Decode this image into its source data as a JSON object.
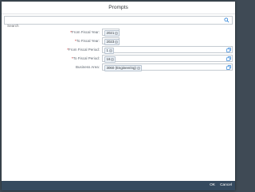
{
  "dialog": {
    "title": "Prompts"
  },
  "search": {
    "placeholder": "Search",
    "value": ""
  },
  "prompts": [
    {
      "label": "From Fiscal Year:",
      "required": true,
      "token": "2021"
    },
    {
      "label": "To Fiscal Year:",
      "required": true,
      "token": "2023"
    },
    {
      "label": "From Fiscal Period:",
      "required": true,
      "token": "1"
    },
    {
      "label": "To Fiscal Period:",
      "required": true,
      "token": "16"
    },
    {
      "label": "Business Area:",
      "required": false,
      "token": "3060 (Engineering)"
    }
  ],
  "footer": {
    "ok_label": "OK",
    "cancel_label": "Cancel"
  },
  "colors": {
    "footer_bg": "#354a5f",
    "required": "#bb0000",
    "icon": "#0a6ed1"
  },
  "icons": {
    "search": "search-icon",
    "value_help": "value-help-icon",
    "remove_token": "close-icon"
  }
}
